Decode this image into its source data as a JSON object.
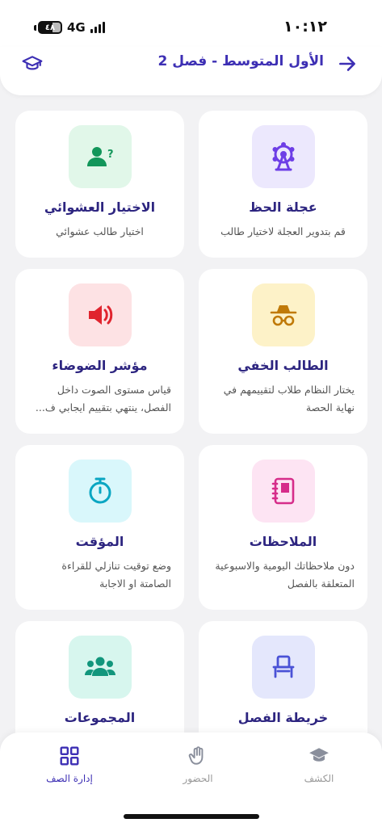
{
  "status": {
    "time": "١٠:١٢",
    "network": "4G",
    "battery": "٤٨"
  },
  "header": {
    "title": "الأول المتوسط - فصل 2",
    "back_icon": "arrow-right-icon",
    "cap_icon": "graduation-cap-icon"
  },
  "colors": {
    "accent": "#3d2fb4",
    "title": "#2d2580"
  },
  "cards": [
    {
      "title": "عجلة الحظ",
      "desc": "قم بتدوير العجلة لاختيار طالب",
      "icon": "ferris-wheel-icon",
      "bg": "#ece8fd"
    },
    {
      "title": "الاختيار العشوائي",
      "desc": "اختيار طالب عشوائي",
      "icon": "user-question-icon",
      "bg": "#e1f7e9"
    },
    {
      "title": "الطالب الخفي",
      "desc": "يختار النظام طلاب لتقييمهم في نهاية الحصة",
      "icon": "incognito-icon",
      "bg": "#fdf2c8"
    },
    {
      "title": "مؤشر الضوضاء",
      "desc": "قياس مستوى الصوت داخل الفصل، ينتهي بتقييم ايجابي ف...",
      "icon": "volume-icon",
      "bg": "#fde2e4"
    },
    {
      "title": "الملاحظات",
      "desc": "دون ملاحظاتك اليومية والاسبوعية المتعلقة بالفصل",
      "icon": "notebook-icon",
      "bg": "#fde4f3"
    },
    {
      "title": "المؤقت",
      "desc": "وضع توقيت تنازلي للقراءة الصامتة او الاجابة",
      "icon": "stopwatch-icon",
      "bg": "#d9f7fb"
    },
    {
      "title": "خريطة الفصل",
      "desc": "",
      "icon": "chair-icon",
      "bg": "#e4e7fc"
    },
    {
      "title": "المجموعات",
      "desc": "",
      "icon": "group-icon",
      "bg": "#d7f6ee"
    }
  ],
  "nav": [
    {
      "label": "الكشف",
      "icon": "graduation-cap-icon"
    },
    {
      "label": "الحضور",
      "icon": "raised-hand-icon"
    },
    {
      "label": "إدارة الصف",
      "icon": "grid-icon"
    }
  ]
}
